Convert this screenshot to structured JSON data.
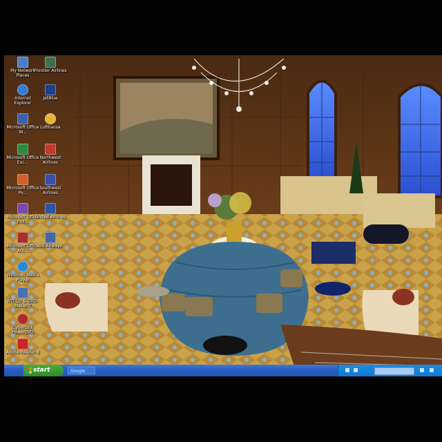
{
  "desktop": {
    "icons": [
      {
        "label": "My Network Places",
        "icon": "network-icon",
        "color": "#4a7fc8"
      },
      {
        "label": "Frontier Airlines",
        "icon": "frontier-icon",
        "color": "#3d6f4f"
      },
      {
        "label": "Internet Explorer",
        "icon": "ie-icon",
        "color": "#2f7fd6"
      },
      {
        "label": "JetBlue",
        "icon": "jetblue-icon",
        "color": "#203f8a"
      },
      {
        "label": "Microsoft Office W...",
        "icon": "word-icon",
        "color": "#3c5fb0"
      },
      {
        "label": "Lufthansa",
        "icon": "lufthansa-icon",
        "color": "#e2b43a"
      },
      {
        "label": "Microsoft Office Exc...",
        "icon": "excel-icon",
        "color": "#2f8a3f"
      },
      {
        "label": "Northwest Airlines",
        "icon": "northwest-icon",
        "color": "#c4392b"
      },
      {
        "label": "Microsoft Office Po...",
        "icon": "powerpoint-icon",
        "color": "#d0602a"
      },
      {
        "label": "Southwest Airlines",
        "icon": "southwest-icon",
        "color": "#3a4fa8"
      },
      {
        "label": "Microsoft Office Pict...",
        "icon": "picture-manager-icon",
        "color": "#7a4ab0"
      },
      {
        "label": "United Airlines",
        "icon": "united-icon",
        "color": "#2a56a8"
      },
      {
        "label": "Microsoft Office Acc...",
        "icon": "access-icon",
        "color": "#a8302a"
      },
      {
        "label": "US Airways",
        "icon": "usairways-icon",
        "color": "#4466aa"
      },
      {
        "label": "Windows Media Player",
        "icon": "media-player-icon",
        "color": "#2f8ad6"
      },
      {
        "label": "NTI CD & DVD-Maker 7",
        "icon": "nti-icon",
        "color": "#4a6fb4"
      },
      {
        "label": "CyberLink PowerDVD",
        "icon": "powerdvd-icon",
        "color": "#b02a2a"
      },
      {
        "label": "Adobe Reader 8",
        "icon": "adobe-reader-icon",
        "color": "#c8242a"
      }
    ]
  },
  "taskbar": {
    "start_label": "start",
    "quicklaunch_label": "Google"
  },
  "colors": {
    "taskbar": "#2456b8",
    "start": "#3a9a32",
    "tray": "#1c8be0"
  }
}
